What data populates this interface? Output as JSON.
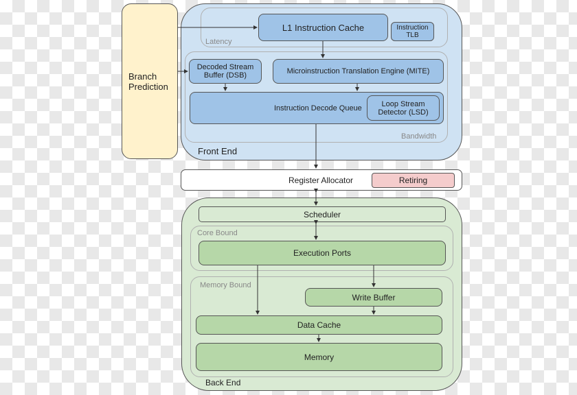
{
  "branch": {
    "label": "Branch\nPrediction"
  },
  "front_end": {
    "label": "Front End",
    "latency_label": "Latency",
    "bandwidth_label": "Bandwidth",
    "l1_cache": "L1 Instruction Cache",
    "itlb": "Instruction TLB",
    "dsb": "Decoded Stream Buffer (DSB)",
    "mite": "Microinstruction Translation Engine (MITE)",
    "idq": "Instruction Decode Queue",
    "lsd": "Loop Stream Detector (LSD)"
  },
  "register_allocator": {
    "label": "Register Allocator",
    "retiring": "Retiring"
  },
  "back_end": {
    "label": "Back End",
    "scheduler": "Scheduler",
    "core_bound_label": "Core Bound",
    "execution_ports": "Execution Ports",
    "memory_bound_label": "Memory Bound",
    "write_buffer": "Write Buffer",
    "data_cache": "Data Cache",
    "memory": "Memory"
  },
  "colors": {
    "front_end_bg": "#cfe2f3",
    "front_end_box": "#9fc3e7",
    "back_end_bg": "#d9ead3",
    "back_end_box": "#b6d7a8",
    "branch_bg": "#fff2cc",
    "retiring_bg": "#f4cccc"
  }
}
